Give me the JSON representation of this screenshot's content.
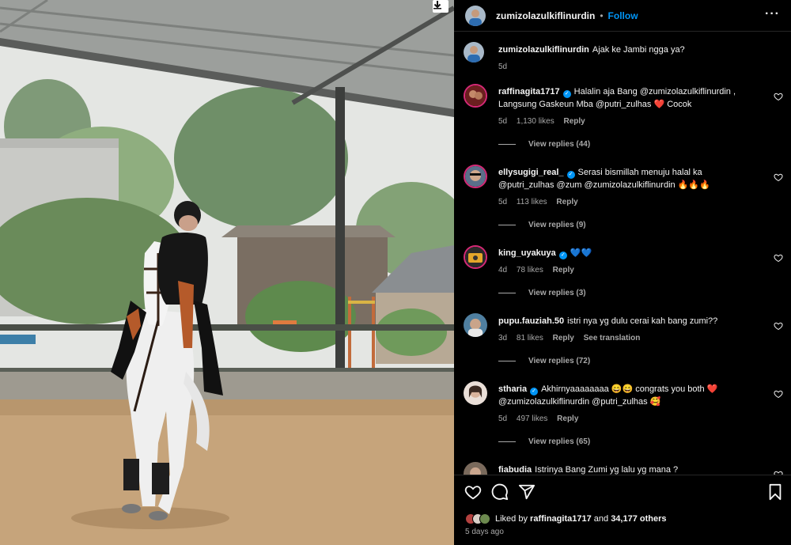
{
  "post": {
    "username": "zumizolazulkiflinurdin",
    "follow_label": "Follow",
    "more_label": "···"
  },
  "caption": {
    "username": "zumizolazulkiflinurdin",
    "text": "Ajak ke Jambi ngga ya?",
    "age": "5d"
  },
  "comments": [
    {
      "username": "raffinagita1717",
      "verified": true,
      "text": "Halalin aja Bang @zumizolazulkiflinurdin , Langsung Gaskeun Mba @putri_zulhas ❤️ Cocok",
      "age": "5d",
      "likes": "1,130 likes",
      "reply": "Reply",
      "view_replies": "View replies (44)"
    },
    {
      "username": "ellysugigi_real_",
      "verified": true,
      "text": "Serasi bismillah menuju halal ka @putri_zulhas @zum @zumizolazulkiflinurdin 🔥🔥🔥",
      "age": "5d",
      "likes": "113 likes",
      "reply": "Reply",
      "view_replies": "View replies (9)"
    },
    {
      "username": "king_uyakuya",
      "verified": true,
      "text": "💙💙",
      "age": "4d",
      "likes": "78 likes",
      "reply": "Reply",
      "view_replies": "View replies (3)"
    },
    {
      "username": "pupu.fauziah.50",
      "verified": false,
      "text": "istri nya yg dulu cerai kah bang zumi??",
      "age": "3d",
      "likes": "81 likes",
      "reply": "Reply",
      "see_translation": "See translation",
      "view_replies": "View replies (72)"
    },
    {
      "username": "stharia",
      "verified": true,
      "text": "Akhirnyaaaaaaaa 😄😄 congrats you both ❤️ @zumizolazulkiflinurdin @putri_zulhas 🥰",
      "age": "5d",
      "likes": "497 likes",
      "reply": "Reply",
      "view_replies": "View replies (65)"
    },
    {
      "username": "fiabudia",
      "verified": false,
      "text": "Istrinya Bang Zumi yg lalu yg mana ?"
    }
  ],
  "likes": {
    "prefix": "Liked by",
    "user": "raffinagita1717",
    "and": "and",
    "others": "34,177 others"
  },
  "timestamp": "5 days ago",
  "colors": {
    "accent": "#0095f6",
    "verified": "#0095f6",
    "heart": "#ed4956",
    "muted": "#a8a8a8"
  }
}
